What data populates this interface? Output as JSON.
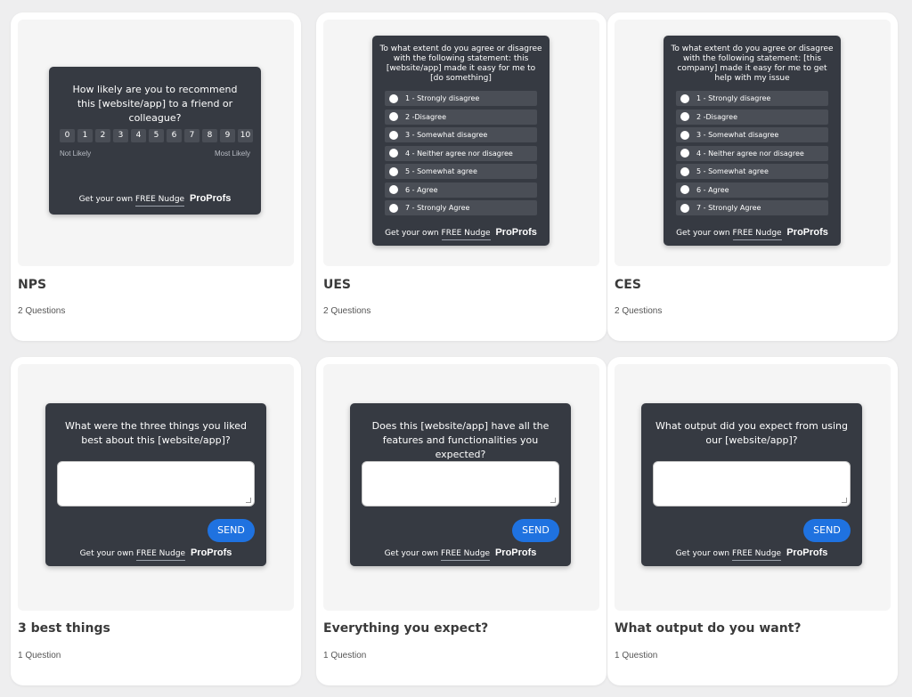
{
  "templates": [
    {
      "title": "NPS",
      "count": "2 Questions",
      "widget": {
        "question": "How likely are you to recommend this [website/app] to a friend or colleague?",
        "scale": [
          "0",
          "1",
          "2",
          "3",
          "4",
          "5",
          "6",
          "7",
          "8",
          "9",
          "10"
        ],
        "low_label": "Not Likely",
        "high_label": "Most Likely",
        "footer_text": "Get your own",
        "footer_link": "FREE Nudge",
        "brand": "ProProfs"
      }
    },
    {
      "title": "UES",
      "count": "2 Questions",
      "widget": {
        "question": "To what extent do you agree or disagree with the following statement: this [website/app] made it easy for me to [do something]",
        "options": [
          "1 - Strongly disagree",
          "2 -Disagree",
          "3 - Somewhat disagree",
          "4 - Neither agree nor disagree",
          "5 - Somewhat agree",
          "6 - Agree",
          "7 - Strongly Agree"
        ],
        "footer_text": "Get your own",
        "footer_link": "FREE Nudge",
        "brand": "ProProfs"
      }
    },
    {
      "title": "CES",
      "count": "2 Questions",
      "widget": {
        "question": "To what extent do you agree or disagree with the following statement: [this company] made it easy for me to get help with my issue",
        "options": [
          "1 - Strongly disagree",
          "2 -Disagree",
          "3 - Somewhat disagree",
          "4 - Neither agree nor disagree",
          "5 - Somewhat agree",
          "6 - Agree",
          "7 - Strongly Agree"
        ],
        "footer_text": "Get your own",
        "footer_link": "FREE Nudge",
        "brand": "ProProfs"
      }
    },
    {
      "title": "3 best things",
      "count": "1 Question",
      "widget": {
        "question": "What were the three things you liked best about this [website/app]?",
        "send": "SEND",
        "footer_text": "Get your own",
        "footer_link": "FREE Nudge",
        "brand": "ProProfs"
      }
    },
    {
      "title": "Everything you expect?",
      "count": "1 Question",
      "widget": {
        "question": "Does this [website/app] have all the features and functionalities you expected?",
        "send": "SEND",
        "footer_text": "Get your own",
        "footer_link": "FREE Nudge",
        "brand": "ProProfs"
      }
    },
    {
      "title": "What output do you want?",
      "count": "1 Question",
      "widget": {
        "question": "What output did you expect from using our [website/app]?",
        "send": "SEND",
        "footer_text": "Get your own",
        "footer_link": "FREE Nudge",
        "brand": "ProProfs"
      }
    }
  ]
}
